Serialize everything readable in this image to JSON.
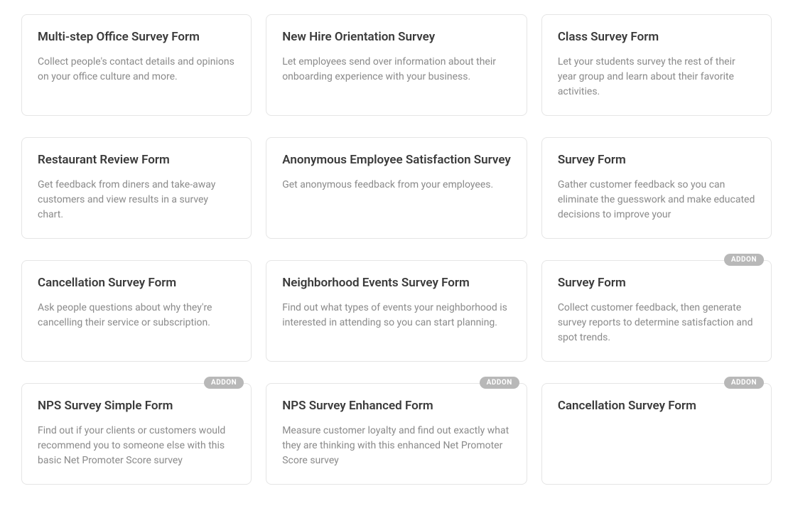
{
  "addon_label": "ADDON",
  "cards": [
    {
      "title": "Multi-step Office Survey Form",
      "desc": "Collect people's contact details and opinions on your office culture and more.",
      "addon": false
    },
    {
      "title": "New Hire Orientation Survey",
      "desc": "Let employees send over information about their onboarding experience with your business.",
      "addon": false
    },
    {
      "title": "Class Survey Form",
      "desc": "Let your students survey the rest of their year group and learn about their favorite activities.",
      "addon": false
    },
    {
      "title": "Restaurant Review Form",
      "desc": "Get feedback from diners and take-away customers and view results in a survey chart.",
      "addon": false
    },
    {
      "title": "Anonymous Employee Satisfaction Survey",
      "desc": "Get anonymous feedback from your employees.",
      "addon": false
    },
    {
      "title": "Survey Form",
      "desc": "Gather customer feedback so you can eliminate the guesswork and make educated decisions to improve your",
      "addon": false
    },
    {
      "title": "Cancellation Survey Form",
      "desc": "Ask people questions about why they're cancelling their service or subscription.",
      "addon": false
    },
    {
      "title": "Neighborhood Events Survey Form",
      "desc": "Find out what types of events your neighborhood is interested in attending so you can start planning.",
      "addon": false
    },
    {
      "title": "Survey Form",
      "desc": "Collect customer feedback, then generate survey reports to determine satisfaction and spot trends.",
      "addon": true
    },
    {
      "title": "NPS Survey Simple Form",
      "desc": "Find out if your clients or customers would recommend you to someone else with this basic Net Promoter Score survey",
      "addon": true
    },
    {
      "title": "NPS Survey Enhanced Form",
      "desc": "Measure customer loyalty and find out exactly what they are thinking with this enhanced Net Promoter Score survey",
      "addon": true
    },
    {
      "title": "Cancellation Survey Form",
      "desc": "",
      "addon": true
    }
  ]
}
